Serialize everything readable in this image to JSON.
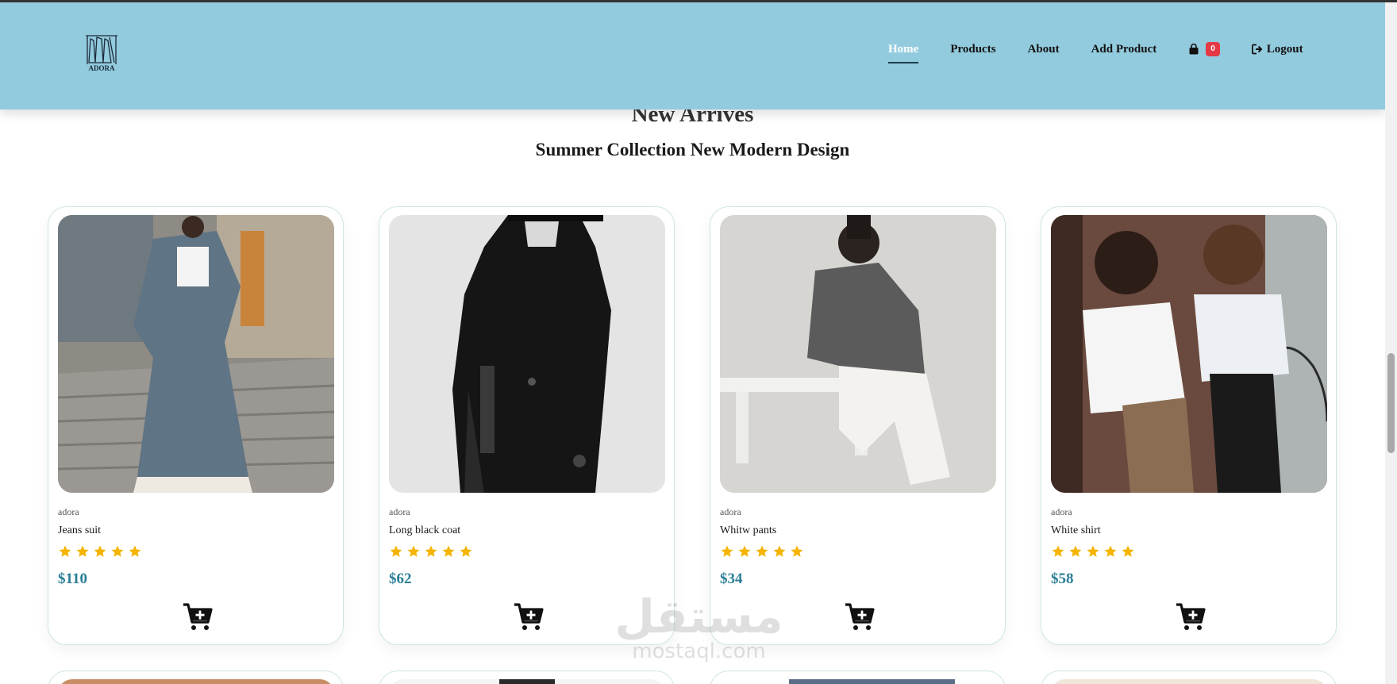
{
  "nav": {
    "logo_text": "ADORA",
    "links": {
      "home": "Home",
      "products": "Products",
      "about": "About",
      "add_product": "Add Product",
      "logout": "Logout"
    },
    "cart_count": "0",
    "active": "Home"
  },
  "section": {
    "title": "New Arrives",
    "subtitle": "Summer Collection New Modern Design"
  },
  "products": [
    {
      "brand": "adora",
      "name": "Jeans suit",
      "price": "$110",
      "rating": 5
    },
    {
      "brand": "adora",
      "name": "Long black coat",
      "price": "$62",
      "rating": 5
    },
    {
      "brand": "adora",
      "name": "Whitw pants",
      "price": "$34",
      "rating": 5
    },
    {
      "brand": "adora",
      "name": "White shirt",
      "price": "$58",
      "rating": 5
    }
  ],
  "watermark": {
    "arabic": "مستقل",
    "latin": "mostaql.com"
  },
  "colors": {
    "navbar": "#93cbde",
    "price": "#2a7f96",
    "star": "#f4b400",
    "badge": "#e63946"
  },
  "icons": [
    "shopping-bag-icon",
    "logout-icon",
    "star-icon",
    "cart-plus-icon"
  ]
}
